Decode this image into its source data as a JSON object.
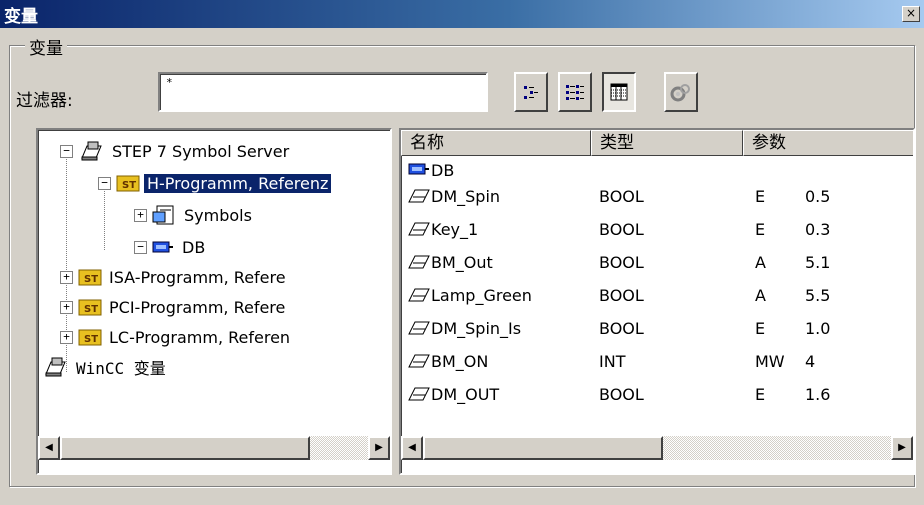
{
  "window": {
    "title": "变量",
    "close_label": "×"
  },
  "group": {
    "label": "变量"
  },
  "filter": {
    "label": "过滤器:",
    "value": "*"
  },
  "toolbar": {
    "buttons": [
      {
        "icon": "list-view-icon"
      },
      {
        "icon": "details-view-icon"
      },
      {
        "icon": "table-view-icon",
        "pressed": true
      },
      {
        "icon": "properties-icon"
      }
    ]
  },
  "tree": {
    "nodes": [
      {
        "label": "STEP 7 Symbol Server",
        "expander": "−",
        "icon": "server-icon"
      },
      {
        "label": "H-Programm, Referenz",
        "expander": "−",
        "icon": "st-folder-icon",
        "selected": true
      },
      {
        "label": "Symbols",
        "expander": "+",
        "icon": "symbol-table-icon"
      },
      {
        "label": "DB",
        "expander": "−",
        "icon": "db-icon"
      },
      {
        "label": "ISA-Programm, Refere",
        "expander": "+",
        "icon": "st-folder-icon"
      },
      {
        "label": "PCI-Programm, Refere",
        "expander": "+",
        "icon": "st-folder-icon"
      },
      {
        "label": "LC-Programm, Referen",
        "expander": "+",
        "icon": "st-folder-icon"
      },
      {
        "label": "WinCC 变量",
        "expander": "+",
        "icon": "server-icon"
      }
    ]
  },
  "table": {
    "columns": [
      "名称",
      "类型",
      "参数"
    ],
    "rows": [
      {
        "name": "DB",
        "type": "",
        "area": "",
        "address": "",
        "icon": "db-icon"
      },
      {
        "name": "DM_Spin",
        "type": "BOOL",
        "area": "E",
        "address": "0.5",
        "icon": "variable-icon"
      },
      {
        "name": "Key_1",
        "type": "BOOL",
        "area": "E",
        "address": "0.3",
        "icon": "variable-icon"
      },
      {
        "name": "BM_Out",
        "type": "BOOL",
        "area": "A",
        "address": "5.1",
        "icon": "variable-icon"
      },
      {
        "name": "Lamp_Green",
        "type": "BOOL",
        "area": "A",
        "address": "5.5",
        "icon": "variable-icon"
      },
      {
        "name": "DM_Spin_Is",
        "type": "BOOL",
        "area": "E",
        "address": "1.0",
        "icon": "variable-icon"
      },
      {
        "name": "BM_ON",
        "type": "INT",
        "area": "MW",
        "address": "4",
        "icon": "variable-icon"
      },
      {
        "name": "DM_OUT",
        "type": "BOOL",
        "area": "E",
        "address": "1.6",
        "icon": "variable-icon"
      }
    ]
  },
  "scroll": {
    "left_arrow": "◀",
    "right_arrow": "▶"
  },
  "colors": {
    "title_start": "#0a246a",
    "title_end": "#a6caf0",
    "selection": "#0a246a",
    "face": "#d4d0c8"
  }
}
